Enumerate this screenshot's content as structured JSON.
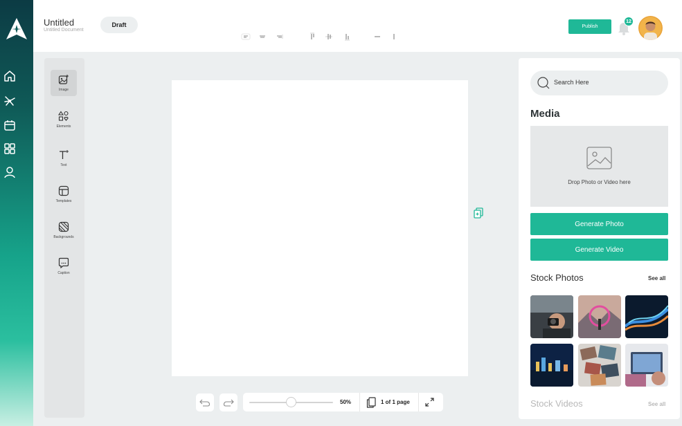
{
  "header": {
    "doc_title": "Untitled",
    "doc_subtitle": "Untitled Document",
    "status_label": "Draft",
    "publish_label": "Publish",
    "notification_count": "12"
  },
  "rail": {
    "items": [
      {
        "icon": "home-icon"
      },
      {
        "icon": "network-icon"
      },
      {
        "icon": "calendar-icon"
      },
      {
        "icon": "grid-icon"
      },
      {
        "icon": "user-icon"
      }
    ]
  },
  "tools": {
    "items": [
      {
        "label": "Image",
        "icon": "image-add-icon",
        "active": true
      },
      {
        "label": "Elements",
        "icon": "shapes-icon",
        "active": false
      },
      {
        "label": "Text",
        "icon": "text-icon",
        "active": false
      },
      {
        "label": "Templates",
        "icon": "template-icon",
        "active": false
      },
      {
        "label": "Backgrounds",
        "icon": "background-icon",
        "active": false
      },
      {
        "label": "Caption",
        "icon": "caption-icon",
        "active": false
      }
    ]
  },
  "bottom": {
    "zoom": "50%",
    "zoom_level": 0.5,
    "pages": "1 of 1 page"
  },
  "panel": {
    "search_placeholder": "Search Here",
    "media_title": "Media",
    "drop_text": "Drop Photo or Video here",
    "generate_photo": "Generate Photo",
    "generate_video": "Generate Video",
    "stock_photos_title": "Stock Photos",
    "stock_photos_see_all": "See all",
    "stock_videos_title": "Stock Videos",
    "stock_videos_see_all": "See all"
  },
  "colors": {
    "accent": "#1fb897",
    "rail_top": "#0c3b44",
    "rail_bottom": "#c8efe3"
  }
}
